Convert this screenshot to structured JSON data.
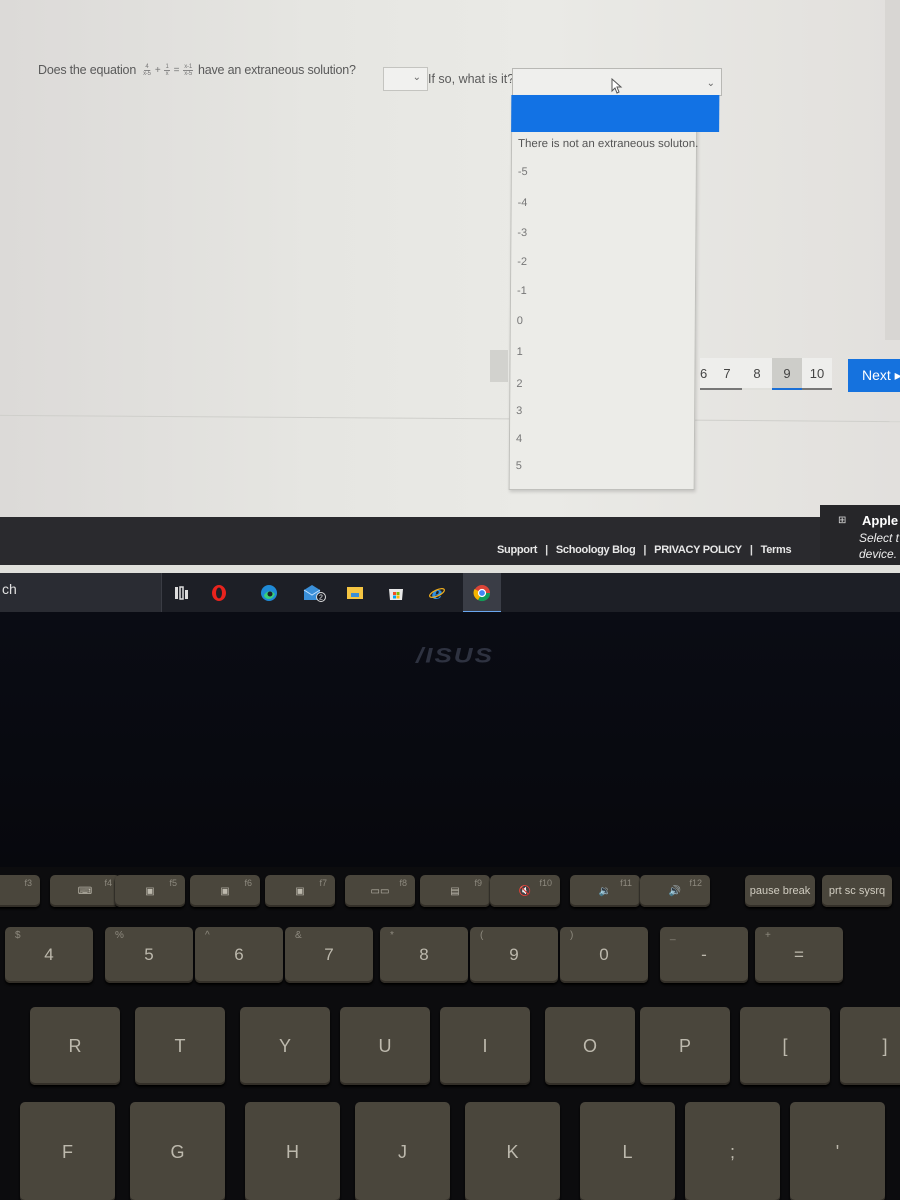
{
  "question": {
    "prefix": "Does the equation",
    "equation": {
      "term1": {
        "num": "4",
        "den": "x-5"
      },
      "op1": "+",
      "term2": {
        "num": "1",
        "den": "x"
      },
      "op2": "=",
      "term3": {
        "num": "x-1",
        "den": "x-5"
      }
    },
    "suffix": "have an extraneous solution?",
    "select1_value": "",
    "followup": "If so, what is it?",
    "select2_value": ""
  },
  "dropdown": {
    "options": [
      "",
      "There is not an extraneous soluton.",
      "-5",
      "-4",
      "-3",
      "-2",
      "-1",
      "0",
      "1",
      "2",
      "3",
      "4",
      "5"
    ],
    "highlighted_index": 0
  },
  "pagination": {
    "pages": [
      "6",
      "7",
      "8",
      "9",
      "10"
    ],
    "current": "9",
    "next_label": "Next ▸"
  },
  "footer": {
    "links": [
      "Support",
      "Schoology Blog",
      "PRIVACY POLICY",
      "Terms"
    ],
    "separator": "|"
  },
  "promo": {
    "icon": "apple-store-icon",
    "title": "Apple",
    "text_line1": "Select t",
    "text_line2": "device."
  },
  "taskbar": {
    "search_text": "ch",
    "apps": [
      "task-view",
      "opera",
      "edge",
      "mail",
      "file-explorer",
      "microsoft-store",
      "internet-explorer",
      "chrome"
    ],
    "mail_badge": "2",
    "active_app": "chrome"
  },
  "laptop": {
    "brand": "/ISUS"
  },
  "keyboard": {
    "fn_row": [
      {
        "label": "f3",
        "icon": ""
      },
      {
        "label": "f4",
        "icon": "⌨"
      },
      {
        "label": "f5",
        "icon": "▣"
      },
      {
        "label": "f6",
        "icon": "▣"
      },
      {
        "label": "f7",
        "icon": "▣"
      },
      {
        "label": "f8",
        "icon": "▭▭"
      },
      {
        "label": "f9",
        "icon": "▤"
      },
      {
        "label": "f10",
        "icon": "🔇"
      },
      {
        "label": "f11",
        "icon": "🔉"
      },
      {
        "label": "f12",
        "icon": "🔊"
      },
      {
        "label": "",
        "icon": "pause break"
      },
      {
        "label": "",
        "icon": "prt sc sysrq"
      }
    ],
    "num_row": [
      {
        "main": "4",
        "shift": "$"
      },
      {
        "main": "5",
        "shift": "%"
      },
      {
        "main": "6",
        "shift": "^"
      },
      {
        "main": "7",
        "shift": "&"
      },
      {
        "main": "8",
        "shift": "*"
      },
      {
        "main": "9",
        "shift": "("
      },
      {
        "main": "0",
        "shift": ")"
      },
      {
        "main": "-",
        "shift": "_"
      },
      {
        "main": "=",
        "shift": "+"
      }
    ],
    "top_row": [
      "R",
      "T",
      "Y",
      "U",
      "I",
      "O",
      "P",
      "[",
      "]"
    ],
    "home_row": [
      "F",
      "G",
      "H",
      "J",
      "K",
      "L",
      ";",
      "'"
    ]
  }
}
